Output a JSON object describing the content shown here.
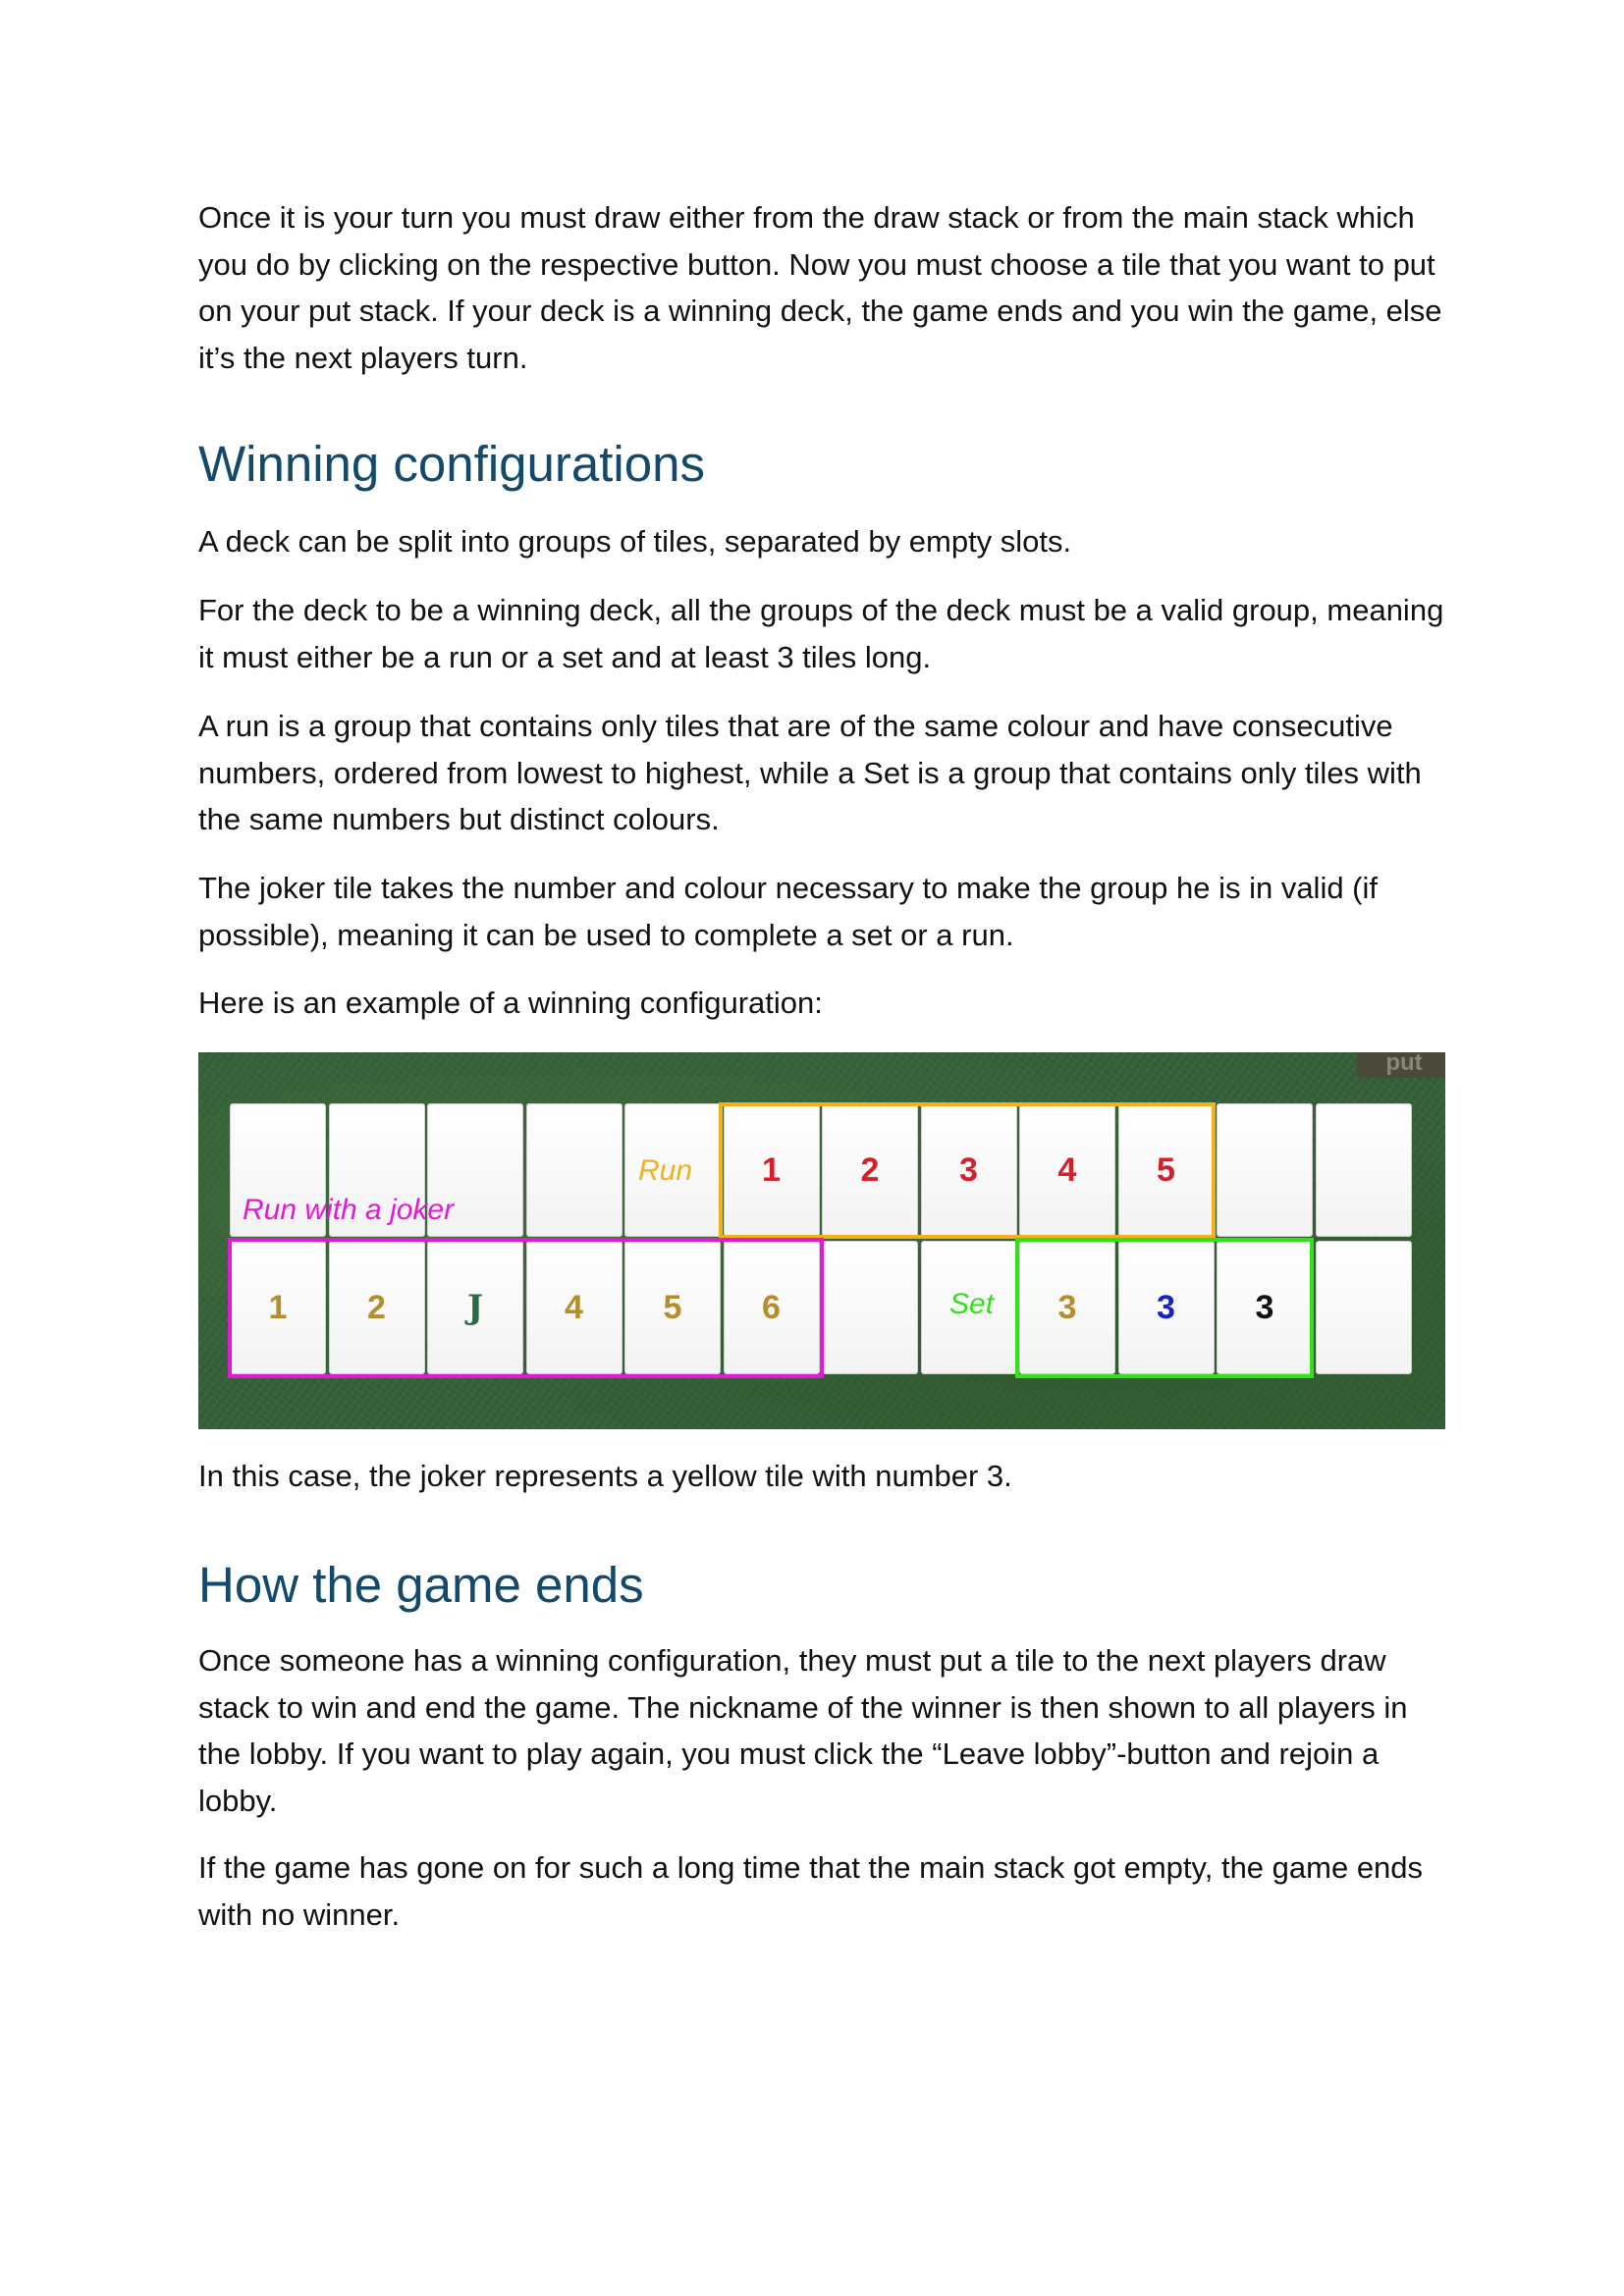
{
  "paragraphs": {
    "intro": "Once it is your turn you must draw either from the draw stack or from the main stack which you do by clicking on the respective button. Now you must choose a tile that you want to put on your put stack. If your deck is a winning deck, the game ends and you win the game, else it’s the next players turn.",
    "groups": "A deck can be split into groups of tiles, separated by empty slots.",
    "winning_deck": "For the deck to be a winning deck, all the groups of the deck must be a valid group, meaning it must either be a run or a set and at least 3 tiles long.",
    "run_set": "A run is a group that contains only tiles that are of the same colour and have consecutive numbers, ordered from lowest to highest, while a Set is a group that contains only tiles with the same numbers but distinct colours.",
    "joker": "The joker tile takes the number and colour necessary to make the group he is in valid (if possible), meaning it can be used to complete a set or a run.",
    "example_intro": "Here is an example of a winning configuration:",
    "joker_case": "In this case, the joker represents a yellow tile with number 3.",
    "ending": "Once someone has a winning configuration, they must put a tile to the next players draw stack to win and end the game. The nickname of the winner is then shown to all players in the lobby. If you want to play again, you must click the “Leave lobby”-button and rejoin a lobby.",
    "no_winner": "If the game has gone on for such a long time that the main stack got empty, the game ends with no winner."
  },
  "headings": {
    "winning": "Winning configurations",
    "end": "How the game ends"
  },
  "figure": {
    "put_button": "put",
    "labels": {
      "run": "Run",
      "run_joker": "Run with a joker",
      "set": "Set"
    },
    "colors": {
      "run_box": "#f2b01c",
      "joker_box": "#e21ad8",
      "set_box": "#34e01a",
      "red": "#d4202a",
      "yellow": "#b58d2a",
      "blue": "#1a22c4",
      "black": "#111111",
      "joker_green": "#2a6a44"
    },
    "row1": [
      "",
      "",
      "",
      "",
      "",
      "1",
      "2",
      "3",
      "4",
      "5",
      "",
      ""
    ],
    "row1_colors": [
      "",
      "",
      "",
      "",
      "",
      "red",
      "red",
      "red",
      "red",
      "red",
      "",
      ""
    ],
    "row2": [
      "1",
      "2",
      "J",
      "4",
      "5",
      "6",
      "",
      "",
      "3",
      "3",
      "3",
      ""
    ],
    "row2_colors": [
      "yellow",
      "yellow",
      "joker_green",
      "yellow",
      "yellow",
      "yellow",
      "",
      "",
      "yellow",
      "blue",
      "black",
      ""
    ]
  }
}
